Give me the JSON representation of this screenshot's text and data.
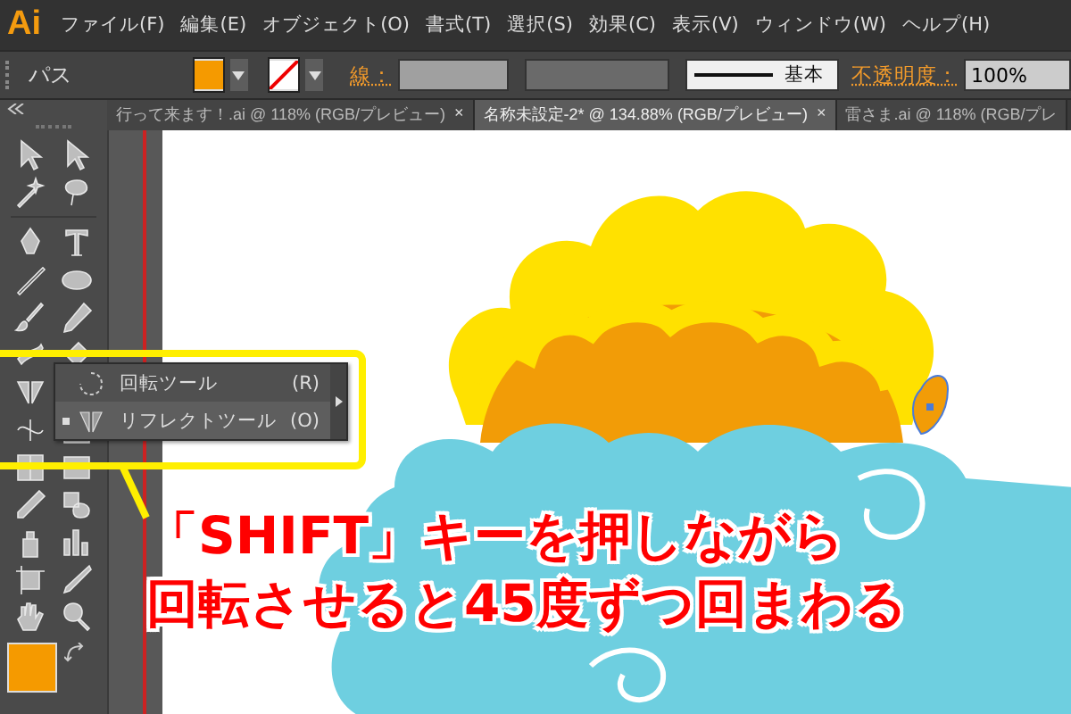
{
  "app": {
    "logo": "Ai"
  },
  "menu": [
    {
      "label": "ファイル(F)"
    },
    {
      "label": "編集(E)"
    },
    {
      "label": "オブジェクト(O)"
    },
    {
      "label": "書式(T)"
    },
    {
      "label": "選択(S)"
    },
    {
      "label": "効果(C)"
    },
    {
      "label": "表示(V)"
    },
    {
      "label": "ウィンドウ(W)"
    },
    {
      "label": "ヘルプ(H)"
    }
  ],
  "control_bar": {
    "selection_label": "パス",
    "stroke_label": "線：",
    "stroke_style": "基本",
    "opacity_label": "不透明度：",
    "opacity_value": "100%"
  },
  "tabs": [
    {
      "label": "行って来ます！.ai @ 118% (RGB/プレビュー)",
      "close": "×",
      "selected": false
    },
    {
      "label": "名称未設定-2* @ 134.88% (RGB/プレビュー)",
      "close": "×",
      "selected": true
    },
    {
      "label": "雷さま.ai @ 118% (RGB/プレ",
      "selected": false
    }
  ],
  "flyout": {
    "items": [
      {
        "label": "回転ツール",
        "shortcut": "(R)",
        "selected": false
      },
      {
        "label": "リフレクトツール",
        "shortcut": "(O)",
        "selected": true
      }
    ]
  },
  "annotation": {
    "lines": [
      "「SHIFT」キーを押しながら",
      "回転させると45度ずつ回まわる"
    ]
  }
}
